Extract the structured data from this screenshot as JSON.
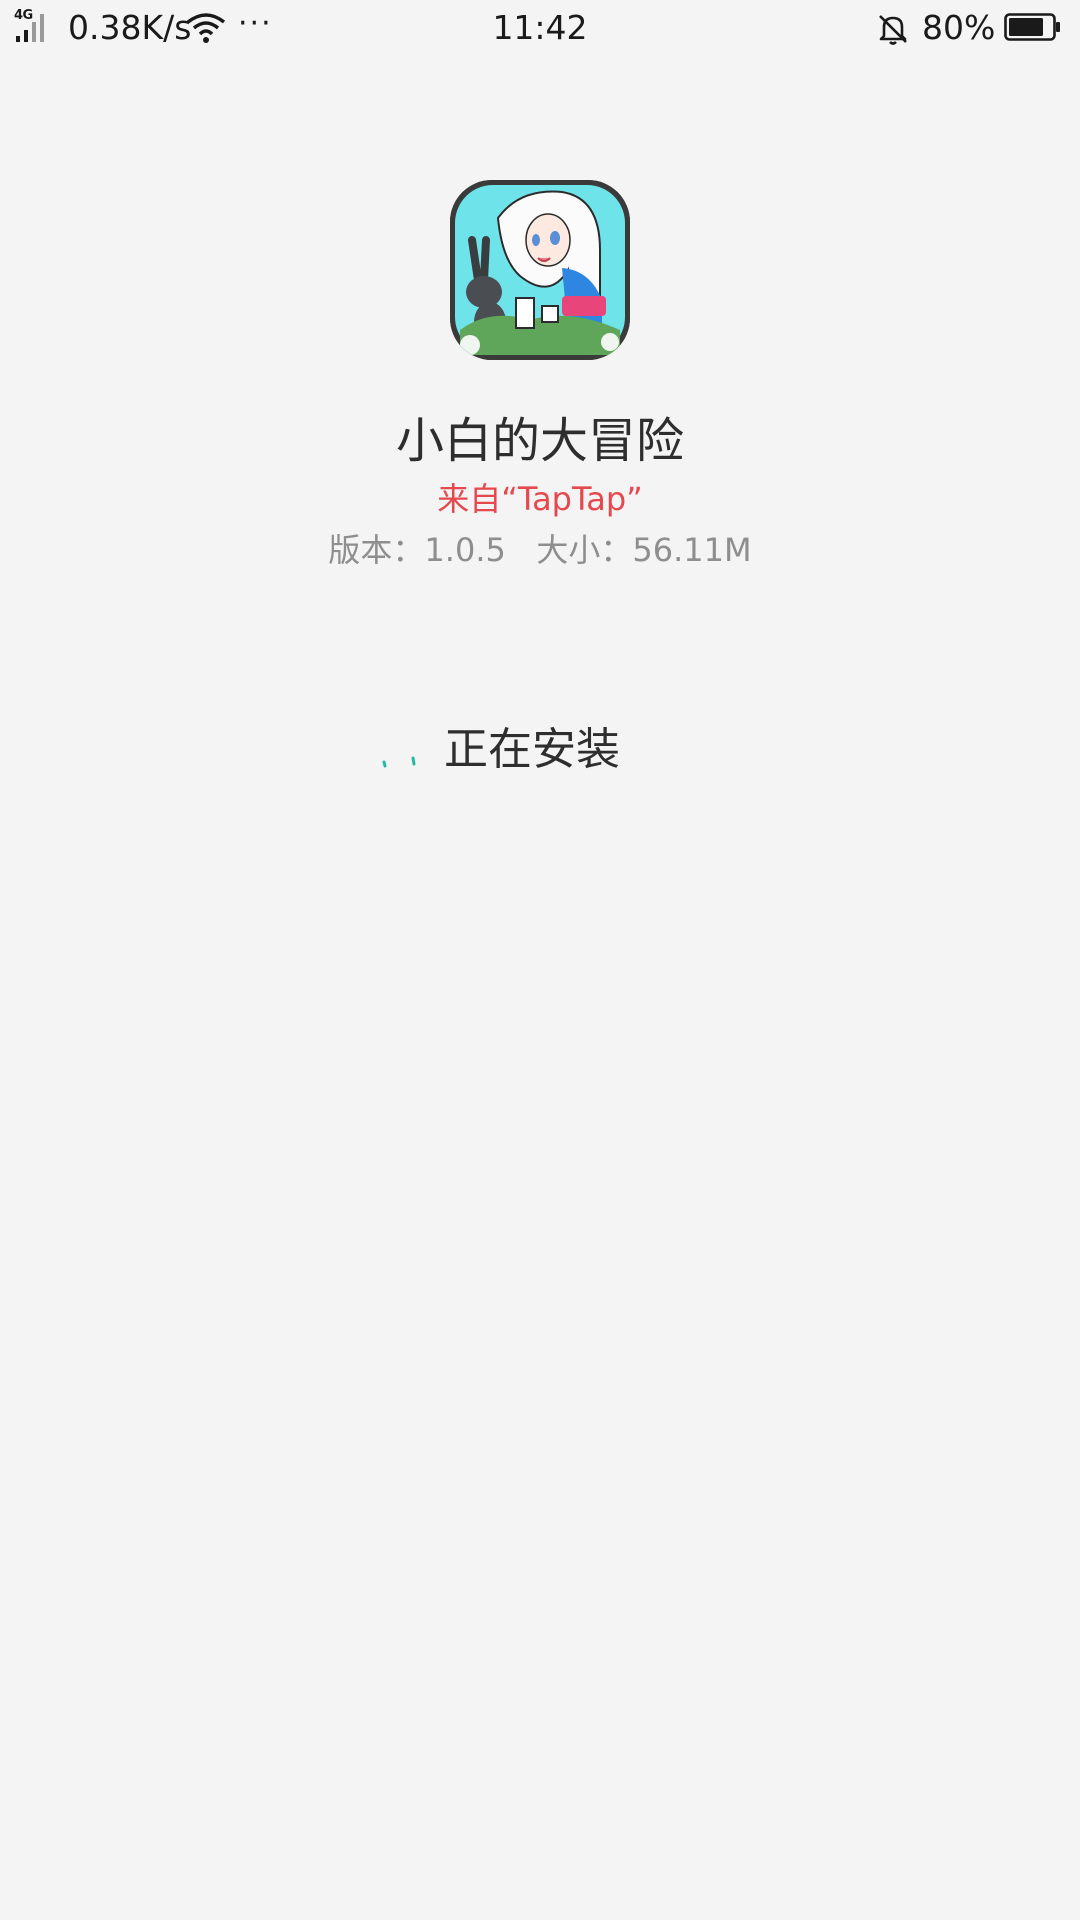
{
  "status_bar": {
    "network_type": "4G",
    "speed": "0.38K/s",
    "more": "···",
    "time": "11:42",
    "battery_percent": "80%",
    "battery_level": 0.8,
    "icons": [
      "signal-icon",
      "wifi-icon",
      "mute-bell-icon",
      "battery-icon"
    ]
  },
  "app": {
    "name": "小白的大冒险",
    "source": "来自“TapTap”",
    "version_label": "版本：",
    "version": "1.0.5",
    "size_label": "大小：",
    "size": "56.11M"
  },
  "install": {
    "status": "正在安装",
    "accent_color": "#25b9a3"
  }
}
